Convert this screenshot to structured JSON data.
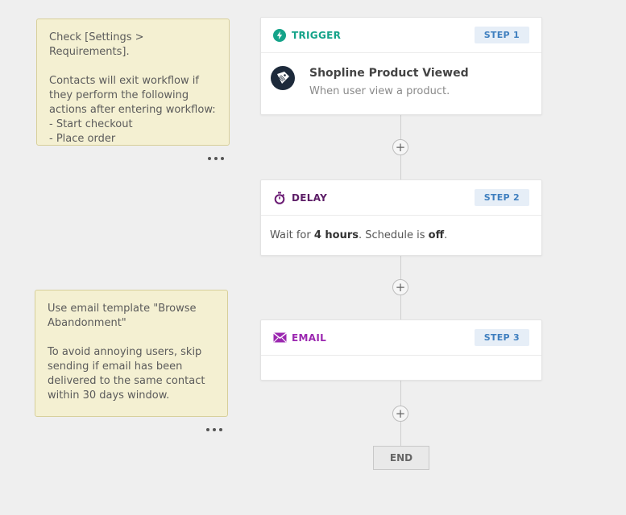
{
  "notes": [
    {
      "text": "Check [Settings > Requirements].\n\nContacts will exit workflow if they perform the following actions after entering workflow:\n- Start checkout\n- Place order"
    },
    {
      "text": "Use email template \"Browse Abandonment\"\n\nTo avoid annoying users, skip sending if email has been delivered to the same contact within 30 days window."
    }
  ],
  "steps": {
    "trigger": {
      "title": "TRIGGER",
      "step": "STEP 1",
      "icon": "lightning-icon",
      "color": "#14a389",
      "event_name": "Shopline Product Viewed",
      "event_desc": "When user view a product."
    },
    "delay": {
      "title": "DELAY",
      "step": "STEP 2",
      "icon": "stopwatch-icon",
      "color": "#6a1b73",
      "prefix": "Wait for ",
      "duration": "4 hours",
      "middle": ". Schedule is ",
      "schedule": "off",
      "suffix": "."
    },
    "email": {
      "title": "EMAIL",
      "step": "STEP 3",
      "icon": "envelope-icon",
      "color": "#9b27b0"
    }
  },
  "end_label": "END",
  "colors": {
    "background": "#efefef",
    "note_bg": "#f4f0d2",
    "step_badge_bg": "#e6eef7",
    "step_badge_text": "#3f7fbf"
  }
}
